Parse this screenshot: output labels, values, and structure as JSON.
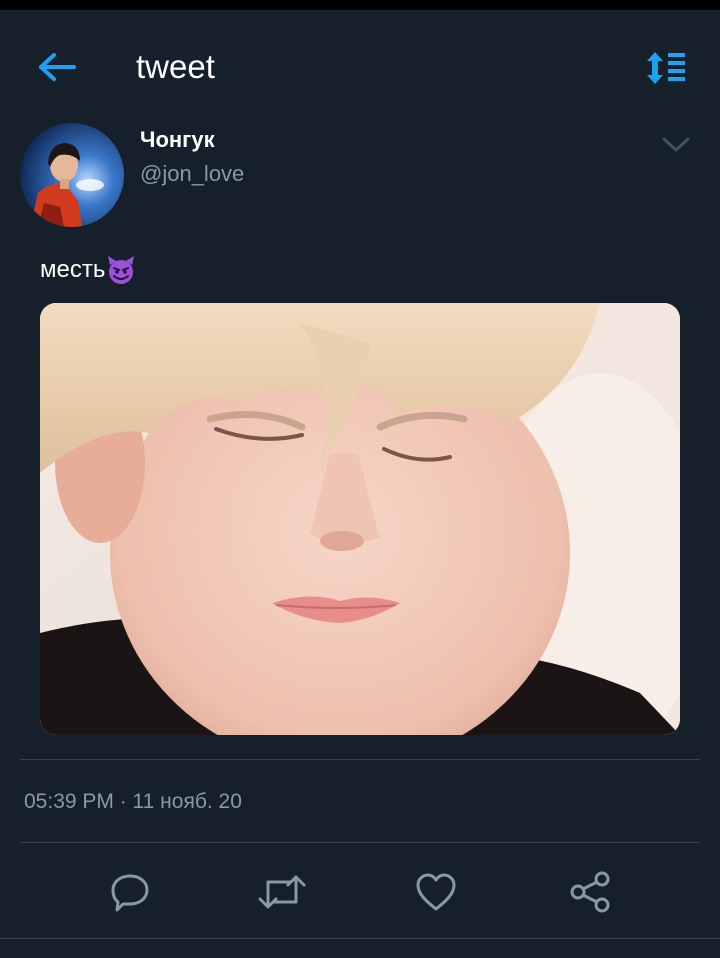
{
  "app_bar": {
    "title": "tweet",
    "back_icon": "arrow-left-icon",
    "sort_icon": "sort-list-icon"
  },
  "tweet": {
    "author_name": "Чонгук",
    "author_handle": "@jon_love",
    "text": "месть",
    "emoji_icon": "smiling-imp-emoji",
    "timestamp": "05:39 PM · 11 нояб. 20",
    "media_icon": "photo-sleeping-person"
  },
  "actions": [
    {
      "name": "reply",
      "icon": "comment-bubble-icon"
    },
    {
      "name": "retweet",
      "icon": "retweet-icon"
    },
    {
      "name": "like",
      "icon": "heart-icon"
    },
    {
      "name": "share",
      "icon": "share-icon"
    }
  ],
  "colors": {
    "background": "#15202b",
    "accent": "#1da1f2",
    "secondary_text": "#8899a6",
    "divider": "#38444d"
  }
}
